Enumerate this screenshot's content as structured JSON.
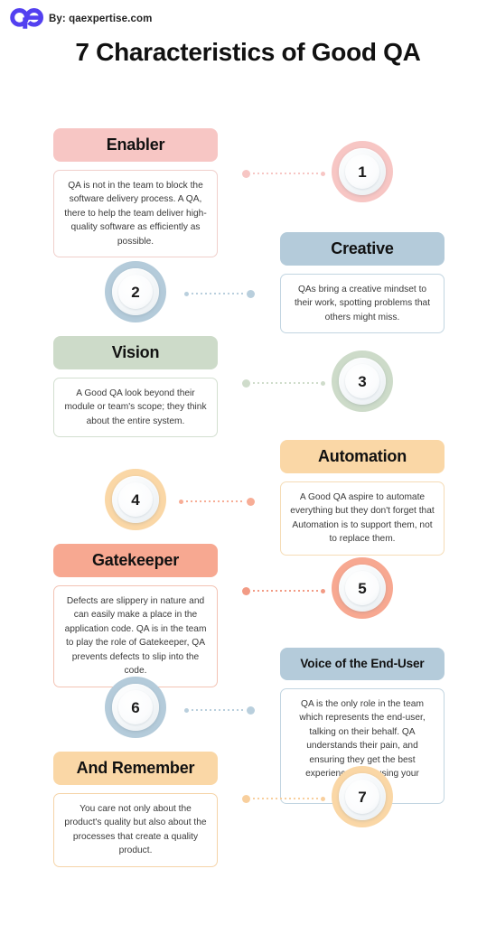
{
  "brand": {
    "logo_icon": "qe-logo-icon",
    "logo_text": "qe",
    "credit": "By: qaexpertise.com",
    "logo_color": "#5340f0"
  },
  "header": {
    "title": "7 Characteristics of Good QA"
  },
  "palette": {
    "pink": "#f7c6c4",
    "pink_soft": "#fbdedd",
    "blue": "#b4cbda",
    "blue_soft": "#cddfe9",
    "green": "#cddbc9",
    "green_soft": "#dfe9dc",
    "orange": "#fad7a6",
    "orange_soft": "#fbe4c2",
    "coral": "#f7a891",
    "coral_soft": "#f9c4b3"
  },
  "items": [
    {
      "number": "1",
      "title": "Enabler",
      "body": "QA is not in the team to block the software delivery process. A QA, there to help the team deliver high-quality software as efficiently as possible.",
      "side": "left",
      "header_bg": "#f7c6c4",
      "ring_color": "#f7c6c4",
      "border_color": "#f0cfcb",
      "connector_color": "#f7c6c4"
    },
    {
      "number": "2",
      "title": "Creative",
      "body": "QAs bring a creative mindset to their work, spotting problems that others might miss.",
      "side": "right",
      "header_bg": "#b4cbda",
      "ring_color": "#b4cbda",
      "border_color": "#c2d5e1",
      "connector_color": "#b9cfdd"
    },
    {
      "number": "3",
      "title": "Vision",
      "body": "A Good QA look beyond their module or team's scope; they think about the entire system.",
      "side": "left",
      "header_bg": "#cddbc9",
      "ring_color": "#cddbc9",
      "border_color": "#d3dfd0",
      "connector_color": "#cfdccb"
    },
    {
      "number": "4",
      "title": "Automation",
      "body": "A Good QA aspire to automate everything but they don't forget that Automation is to support them, not to replace them.",
      "side": "right",
      "header_bg": "#fad7a6",
      "ring_color": "#fad7a6",
      "border_color": "#f5dcb6",
      "connector_color": "#f7ad96"
    },
    {
      "number": "5",
      "title": "Gatekeeper",
      "body": "Defects are slippery in nature and can easily make a place in the application code. QA is in the team to play the role of Gatekeeper, QA prevents defects to slip into the code.",
      "side": "left",
      "header_bg": "#f7a891",
      "ring_color": "#f7a891",
      "border_color": "#f3c3b4",
      "connector_color": "#f29b85"
    },
    {
      "number": "6",
      "title": "Voice of the End-User",
      "body": "QA is the only role in the team which represents the end-user, talking on their behalf. QA understands their pain, and ensuring they get the best experience while using your software.",
      "side": "right",
      "header_bg": "#b4cbda",
      "ring_color": "#b4cbda",
      "border_color": "#c2d5e1",
      "connector_color": "#b9cfdd"
    },
    {
      "number": "7",
      "title": "And Remember",
      "body": "You care not only about the product's quality but also about the processes that create a quality product.",
      "side": "left",
      "header_bg": "#fad7a6",
      "ring_color": "#fad7a6",
      "border_color": "#f5d4a8",
      "connector_color": "#f8cf9d"
    }
  ]
}
